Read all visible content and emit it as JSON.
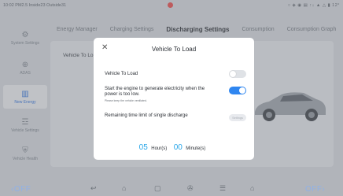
{
  "status": {
    "left": "10:02 PM2.5 Inside23 Outside31",
    "right": "○ ◈ ◉ ▤ ↑↓ ▲ △ ▮ 12°"
  },
  "sidebar": [
    {
      "label": "System Settings",
      "icon": "gear-icon",
      "glyph": "⚙"
    },
    {
      "label": "ADAS",
      "icon": "steering-wheel-icon",
      "glyph": "⊕"
    },
    {
      "label": "New Energy",
      "icon": "battery-icon",
      "glyph": "▥"
    },
    {
      "label": "Vehicle Settings",
      "icon": "car-icon",
      "glyph": "☲"
    },
    {
      "label": "Vehicle Health",
      "icon": "health-icon",
      "glyph": "⛨"
    }
  ],
  "tabs": [
    "Energy Manager",
    "Charging Settings",
    "Discharging Settings",
    "Consumption",
    "Consumption Graph"
  ],
  "content": {
    "row_label": "Vehicle To Lo"
  },
  "dialog": {
    "title": "Vehicle To Load",
    "vtl_label": "Vehicle To Load",
    "engine_label": "Start the engine to generate electricity when the power is too low.",
    "engine_sub": "Please keep the vehicle ventilated.",
    "time_limit_label": "Remaining time limit of single discharge",
    "settings_button": "Settings",
    "hours": "05",
    "hours_unit": "Hour(s)",
    "minutes": "00",
    "minutes_unit": "Minute(s)",
    "vtl_enabled": false,
    "engine_enabled": true
  },
  "bottom": {
    "left_label": "OFF",
    "right_label": "OFF"
  },
  "colors": {
    "accent": "#2f86f0",
    "time": "#28a6e8"
  }
}
